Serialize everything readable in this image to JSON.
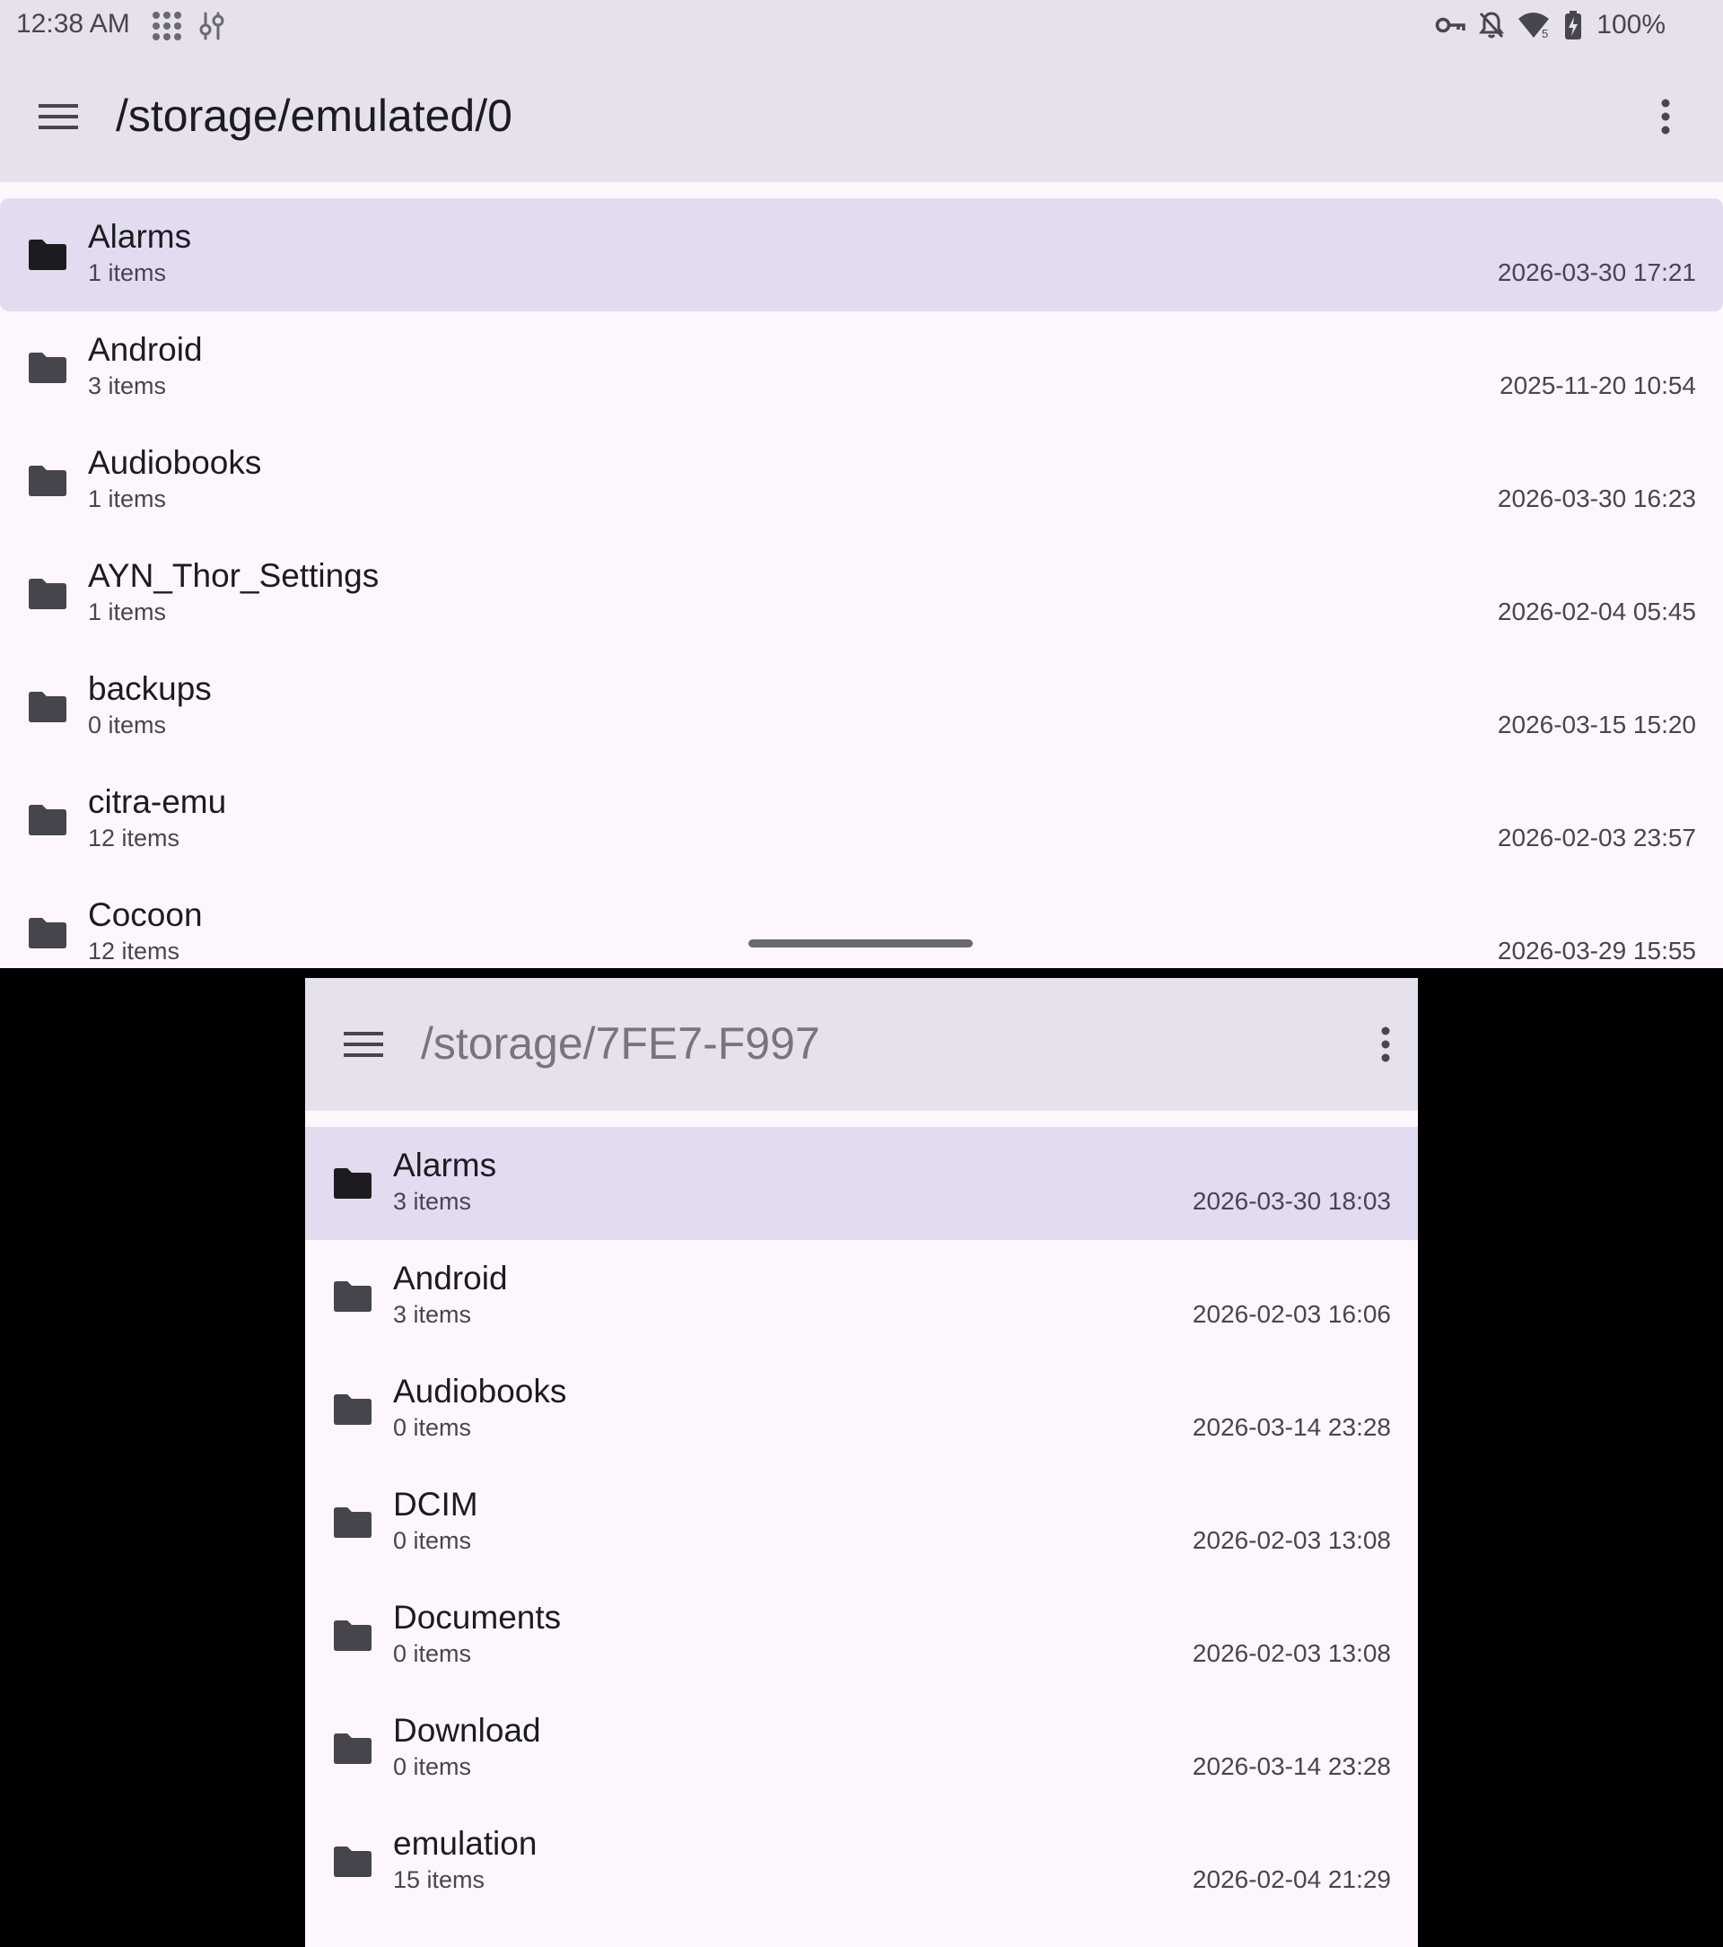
{
  "status_bar": {
    "time": "12:38 AM",
    "battery_percent": "100%",
    "left_icons": [
      "apps-grid-icon",
      "tune-icon"
    ],
    "right_icons": [
      "vpn-key-icon",
      "notifications-off-icon",
      "wifi-5-icon",
      "battery-charging-icon"
    ]
  },
  "top_pane": {
    "path": "/storage/emulated/0",
    "selected_index": 0,
    "files": [
      {
        "name": "Alarms",
        "count": "1 items",
        "date": "2026-03-30 17:21"
      },
      {
        "name": "Android",
        "count": "3 items",
        "date": "2025-11-20 10:54"
      },
      {
        "name": "Audiobooks",
        "count": "1 items",
        "date": "2026-03-30 16:23"
      },
      {
        "name": "AYN_Thor_Settings",
        "count": "1 items",
        "date": "2026-02-04 05:45"
      },
      {
        "name": "backups",
        "count": "0 items",
        "date": "2026-03-15 15:20"
      },
      {
        "name": "citra-emu",
        "count": "12 items",
        "date": "2026-02-03 23:57"
      },
      {
        "name": "Cocoon",
        "count": "12 items",
        "date": "2026-03-29 15:55"
      }
    ]
  },
  "bottom_pane": {
    "path": "/storage/7FE7-F997",
    "selected_index": 0,
    "files": [
      {
        "name": "Alarms",
        "count": "3 items",
        "date": "2026-03-30 18:03"
      },
      {
        "name": "Android",
        "count": "3 items",
        "date": "2026-02-03 16:06"
      },
      {
        "name": "Audiobooks",
        "count": "0 items",
        "date": "2026-03-14 23:28"
      },
      {
        "name": "DCIM",
        "count": "0 items",
        "date": "2026-02-03 13:08"
      },
      {
        "name": "Documents",
        "count": "0 items",
        "date": "2026-02-03 13:08"
      },
      {
        "name": "Download",
        "count": "0 items",
        "date": "2026-03-14 23:28"
      },
      {
        "name": "emulation",
        "count": "15 items",
        "date": "2026-02-04 21:29"
      }
    ]
  },
  "colors": {
    "surface": "#fdf7fd",
    "app_bar": "#e6e1ec",
    "selected_row": "#e3dbef",
    "text_primary": "#1d1b20",
    "text_secondary": "#49454f",
    "folder_icon": "#46444c",
    "folder_icon_selected": "#1d1b20"
  }
}
